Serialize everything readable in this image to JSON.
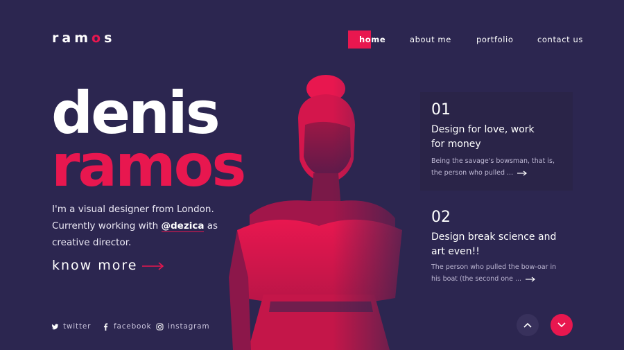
{
  "brand": {
    "logo_pre": "ram",
    "logo_dot": "o",
    "logo_post": "s"
  },
  "nav": {
    "home": "home",
    "about": "about me",
    "portfolio": "portfolio",
    "contact": "contact us",
    "active": "home"
  },
  "hero": {
    "first_name": "denis",
    "last_name": "ramos",
    "intro_line1": "I'm a visual designer from London.",
    "intro_line2_pre": "Currently working with ",
    "intro_handle": "@dezica",
    "intro_line2_post": " as",
    "intro_line3": "creative director.",
    "cta": "know more"
  },
  "features": [
    {
      "number": "01",
      "title_line1": "Design for love, work",
      "title_line2": "for money",
      "text_line1": "Being the savage's bowsman, that is,",
      "text_line2": "the person who pulled ..."
    },
    {
      "number": "02",
      "title_line1": "Design break science and",
      "title_line2": "art even!!",
      "text_line1": "The person who pulled the bow-oar in",
      "text_line2": "his boat (the second one ..."
    }
  ],
  "socials": [
    {
      "label": "twitter",
      "icon": "twitter-icon"
    },
    {
      "label": "facebook",
      "icon": "facebook-icon"
    },
    {
      "label": "instagram",
      "icon": "instagram-icon"
    }
  ],
  "colors": {
    "background": "#2c2650",
    "accent": "#e8174f",
    "card": "#2a2448",
    "text_muted": "#bdb7d3"
  }
}
